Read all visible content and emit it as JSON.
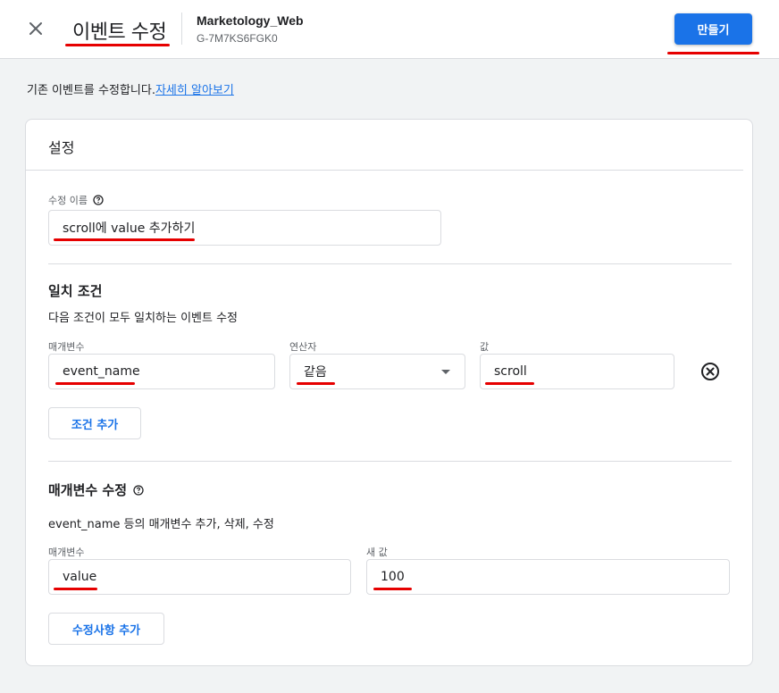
{
  "header": {
    "title": "이벤트 수정",
    "stream_name": "Marketology_Web",
    "stream_id": "G-7M7KS6FGK0",
    "create_label": "만들기"
  },
  "intro": {
    "text": "기존 이벤트를 수정합니다.",
    "link": "자세히 알아보기"
  },
  "settings": {
    "title": "설정",
    "modification_name_label": "수정 이름",
    "modification_name_value": "scroll에 value 추가하기"
  },
  "matching": {
    "title": "일치 조건",
    "description": "다음 조건이 모두 일치하는 이벤트 수정",
    "param_label": "매개변수",
    "param_value": "event_name",
    "operator_label": "연산자",
    "operator_value": "같음",
    "value_label": "값",
    "value_value": "scroll",
    "add_condition_label": "조건 추가"
  },
  "param_mod": {
    "title": "매개변수 수정",
    "description": "event_name 등의 매개변수 추가, 삭제, 수정",
    "param_label": "매개변수",
    "param_value": "value",
    "new_value_label": "새 값",
    "new_value_value": "100",
    "add_modification_label": "수정사항 추가"
  },
  "icons": {
    "close": "close-icon",
    "help": "help-icon",
    "dropdown": "chevron-down-icon",
    "remove": "remove-circle-icon"
  },
  "colors": {
    "accent": "#1a73e8",
    "annotation": "#e60000",
    "background": "#f1f3f4"
  }
}
